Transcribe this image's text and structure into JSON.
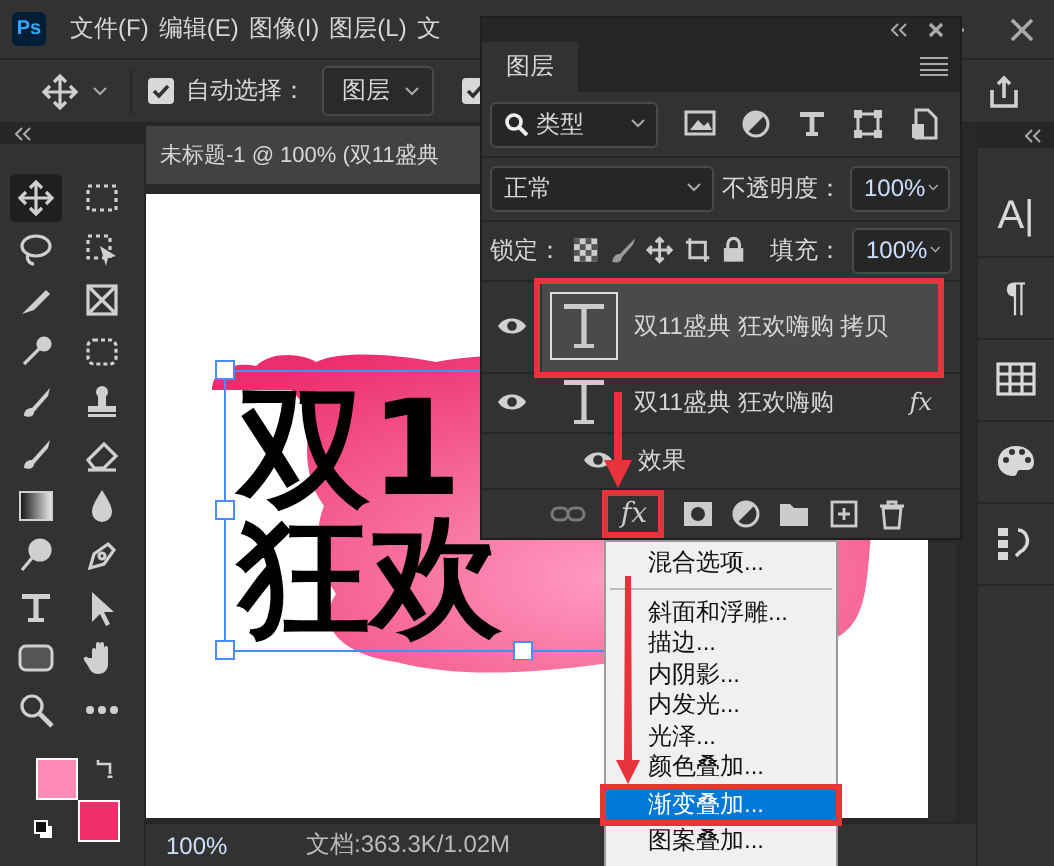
{
  "app": {
    "logo": "Ps"
  },
  "menu_bar": [
    "文件(F)",
    "编辑(E)",
    "图像(I)",
    "图层(L)",
    "文"
  ],
  "options_bar": {
    "auto_select": {
      "label": "自动选择：",
      "checked": true
    },
    "auto_select_target": "图层",
    "transform_controls": {
      "checked": true
    }
  },
  "tools": [
    {
      "kind": "move",
      "selected": true
    },
    {
      "kind": "marquee",
      "selected": false
    },
    {
      "kind": "lasso",
      "selected": false
    },
    {
      "kind": "selection",
      "selected": false
    },
    {
      "kind": "knife",
      "selected": false
    },
    {
      "kind": "frame",
      "selected": false
    },
    {
      "kind": "eyedropper",
      "selected": false
    },
    {
      "kind": "bandage",
      "selected": false
    },
    {
      "kind": "brush",
      "selected": false
    },
    {
      "kind": "stamp",
      "selected": false
    },
    {
      "kind": "brush",
      "selected": false
    },
    {
      "kind": "eraser",
      "selected": false
    },
    {
      "kind": "gradient",
      "selected": false
    },
    {
      "kind": "drop",
      "selected": false
    },
    {
      "kind": "lollipop",
      "selected": false
    },
    {
      "kind": "pen",
      "selected": false
    },
    {
      "kind": "type",
      "selected": false
    },
    {
      "kind": "cursor",
      "selected": false
    },
    {
      "kind": "rectangle",
      "selected": false
    },
    {
      "kind": "hand",
      "selected": false
    },
    {
      "kind": "zoom",
      "selected": false
    },
    {
      "kind": "more",
      "selected": false
    }
  ],
  "swatches": [
    {
      "kind": "foreground",
      "color": "#fe8bb6"
    },
    {
      "kind": "background",
      "color": "#ef2f6c"
    }
  ],
  "document": {
    "tab_title": "未标题-1 @ 100% (双11盛典",
    "artwork_lines": [
      "双1",
      "狂欢"
    ],
    "zoom": "100%",
    "doc_info": "文档:363.3K/1.02M"
  },
  "dock": [
    {
      "kind": "glyph",
      "symbol": "A|"
    },
    {
      "kind": "glyph",
      "symbol": "¶"
    },
    {
      "kind": "grid"
    },
    {
      "kind": "palette"
    },
    {
      "kind": "history"
    }
  ],
  "layers_panel": {
    "tab": "图层",
    "filter": "类型",
    "blend_mode": "正常",
    "opacity_label": "不透明度：",
    "opacity": "100%",
    "lock_label": "锁定：",
    "fill_label": "填充：",
    "fill": "100%",
    "layers": [
      {
        "name": "双11盛典 狂欢嗨购 拷贝",
        "kind": "text",
        "visible": true,
        "selected": true,
        "callout": true
      },
      {
        "name": "双11盛典 狂欢嗨购",
        "kind": "text",
        "visible": true,
        "selected": false,
        "callout": false,
        "fx_label": "fx",
        "effects_label": "效果"
      }
    ],
    "fx_button": {
      "label": "fx",
      "callout": true
    }
  },
  "fx_menu": [
    {
      "kind": "item",
      "label": "混合选项...",
      "selected": false
    },
    {
      "kind": "separator"
    },
    {
      "kind": "item",
      "label": "斜面和浮雕...",
      "selected": false
    },
    {
      "kind": "item",
      "label": "描边...",
      "selected": false
    },
    {
      "kind": "item",
      "label": "内阴影...",
      "selected": false
    },
    {
      "kind": "item",
      "label": "内发光...",
      "selected": false
    },
    {
      "kind": "item",
      "label": "光泽...",
      "selected": false
    },
    {
      "kind": "item",
      "label": "颜色叠加...",
      "selected": false
    },
    {
      "kind": "item",
      "label": "渐变叠加...",
      "selected": true
    },
    {
      "kind": "item",
      "label": "图案叠加...",
      "selected": false
    }
  ]
}
